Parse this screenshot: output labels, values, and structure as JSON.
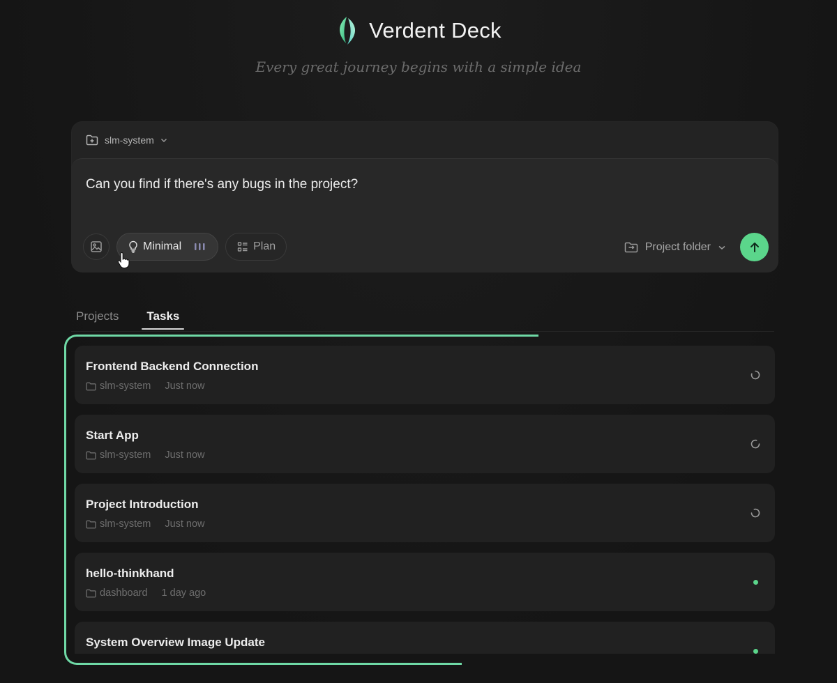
{
  "header": {
    "app_title": "Verdent Deck",
    "tagline": "Every great journey begins with a simple idea"
  },
  "composer": {
    "project_name": "slm-system",
    "prompt_text": "Can you find if there's any bugs in the project?",
    "mode_label": "Minimal",
    "plan_label": "Plan",
    "folder_label": "Project folder"
  },
  "tabs": [
    {
      "label": "Projects",
      "active": false
    },
    {
      "label": "Tasks",
      "active": true
    }
  ],
  "tasks": [
    {
      "title": "Frontend Backend Connection",
      "project": "slm-system",
      "time": "Just now",
      "status": "loading"
    },
    {
      "title": "Start App",
      "project": "slm-system",
      "time": "Just now",
      "status": "loading"
    },
    {
      "title": "Project Introduction",
      "project": "slm-system",
      "time": "Just now",
      "status": "loading"
    },
    {
      "title": "hello-thinkhand",
      "project": "dashboard",
      "time": "1 day ago",
      "status": "done"
    },
    {
      "title": "System Overview Image Update",
      "project": "",
      "time": "",
      "status": "done"
    }
  ],
  "colors": {
    "accent": "#5bd68b",
    "highlight": "#6fd9a6",
    "background": "#151515"
  },
  "icons": {
    "logo": "leaf-logo-icon",
    "project": "folder-plus-icon",
    "image": "image-icon",
    "mode": "lightbulb-icon",
    "plan": "list-checklist-icon",
    "folder": "folder-swap-icon",
    "send": "arrow-up-icon",
    "task_folder": "folder-icon",
    "loading": "spinner-icon",
    "done": "status-dot-icon"
  }
}
